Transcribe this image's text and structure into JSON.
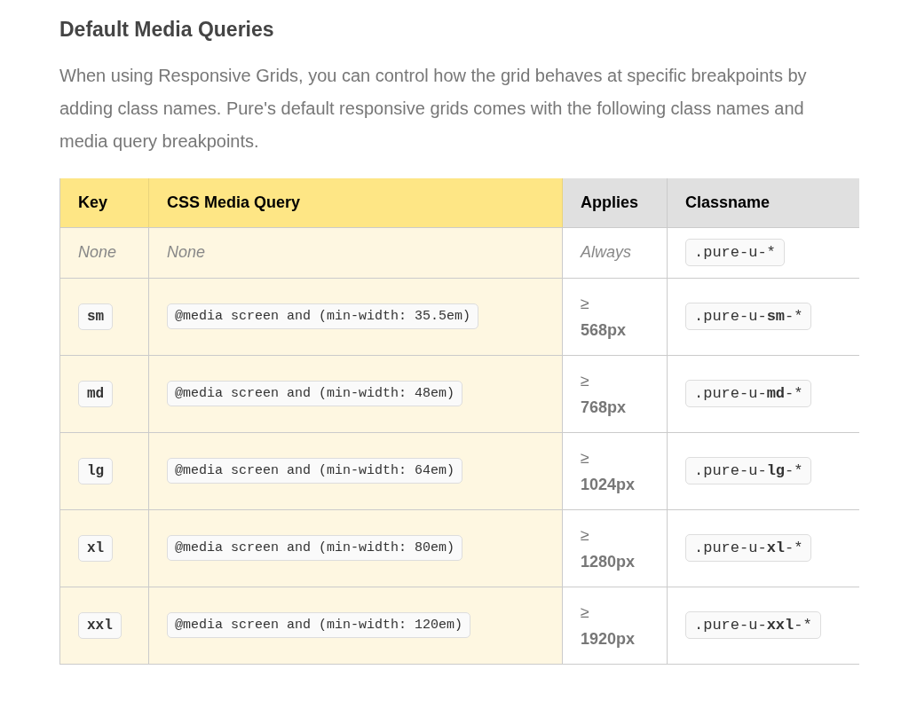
{
  "heading": "Default Media Queries",
  "intro": "When using Responsive Grids, you can control how the grid behaves at specific breakpoints by adding class names. Pure's default responsive grids comes with the following class names and media query breakpoints.",
  "table": {
    "columns": [
      "Key",
      "CSS Media Query",
      "Applies",
      "Classname"
    ],
    "rows": [
      {
        "kind": "default",
        "key": "None",
        "query": "None",
        "applies": "Always",
        "classname": ".pure-u-*"
      },
      {
        "kind": "breakpoint",
        "key": "sm",
        "query": "@media screen and (min-width: 35.5em)",
        "applies": "≥ **568px**",
        "classname": ".pure-u-**sm**-*"
      },
      {
        "kind": "breakpoint",
        "key": "md",
        "query": "@media screen and (min-width: 48em)",
        "applies": "≥ **768px**",
        "classname": ".pure-u-**md**-*"
      },
      {
        "kind": "breakpoint",
        "key": "lg",
        "query": "@media screen and (min-width: 64em)",
        "applies": "≥ **1024px**",
        "classname": ".pure-u-**lg**-*"
      },
      {
        "kind": "breakpoint",
        "key": "xl",
        "query": "@media screen and (min-width: 80em)",
        "applies": "≥ **1280px**",
        "classname": ".pure-u-**xl**-*"
      },
      {
        "kind": "breakpoint",
        "key": "xxl",
        "query": "@media screen and (min-width: 120em)",
        "applies": "≥ **1920px**",
        "classname": ".pure-u-**xxl**-*"
      }
    ]
  }
}
